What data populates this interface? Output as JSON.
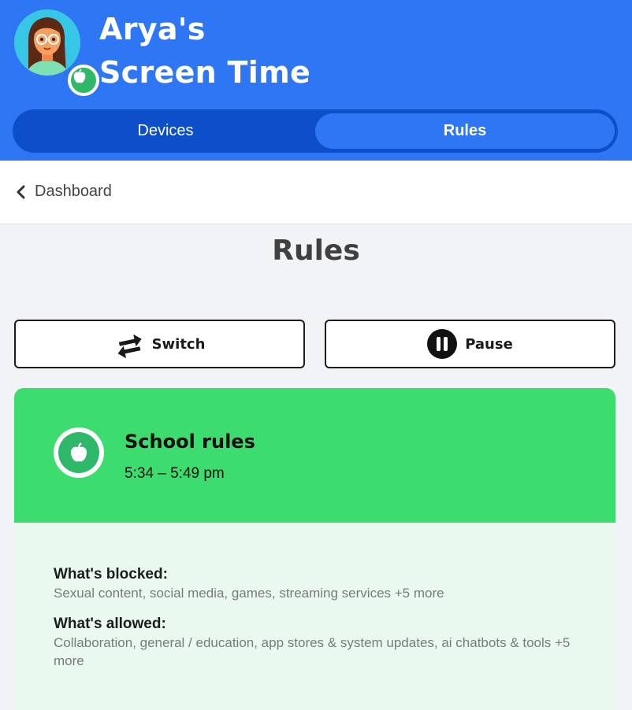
{
  "header": {
    "title_line1": "Arya's",
    "title_line2": "Screen Time"
  },
  "tabs": [
    {
      "label": "Devices",
      "active": false
    },
    {
      "label": "Rules",
      "active": true
    }
  ],
  "breadcrumb": {
    "back_label": "Dashboard"
  },
  "page": {
    "title": "Rules"
  },
  "actions": {
    "switch_label": "Switch",
    "pause_label": "Pause"
  },
  "rule_card": {
    "name": "School rules",
    "time_range": "5:34 – 5:49 pm",
    "blocked_label": "What's blocked:",
    "blocked_value": "Sexual content, social media, games, streaming services +5 more",
    "allowed_label": "What's allowed:",
    "allowed_value": "Collaboration, general / education, app stores & system updates, ai chatbots & tools +5 more"
  },
  "colors": {
    "header_blue": "#2f76f5",
    "tab_track": "#0c4fc9",
    "card_green": "#3ddc6e",
    "card_body": "#e9f9ef",
    "badge_green": "#2fb76a"
  },
  "icons": {
    "avatar": "child-avatar",
    "badge": "apple-icon",
    "back": "chevron-left-icon",
    "switch": "swap-arrows-icon",
    "pause": "pause-icon",
    "rule": "apple-icon"
  }
}
